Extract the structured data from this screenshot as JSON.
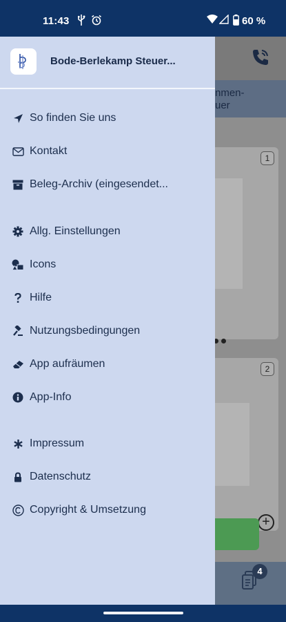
{
  "status_bar": {
    "time": "11:43",
    "battery_text": "60 %"
  },
  "drawer": {
    "title": "Bode-Berlekamp Steuer...",
    "menu_items": [
      {
        "label": "So finden Sie uns",
        "icon": "location-arrow-icon"
      },
      {
        "label": "Kontakt",
        "icon": "envelope-icon"
      },
      {
        "label": "Beleg-Archiv (eingesendet...",
        "icon": "archive-icon"
      },
      {
        "label": "Allg. Einstellungen",
        "icon": "gear-icon"
      },
      {
        "label": "Icons",
        "icon": "shapes-icon"
      },
      {
        "label": "Hilfe",
        "icon": "question-icon"
      },
      {
        "label": "Nutzungsbedingungen",
        "icon": "gavel-icon"
      },
      {
        "label": "App aufräumen",
        "icon": "eraser-icon"
      },
      {
        "label": "App-Info",
        "icon": "info-icon"
      },
      {
        "label": "Impressum",
        "icon": "asterisk-icon"
      },
      {
        "label": "Datenschutz",
        "icon": "lock-icon"
      },
      {
        "label": "Copyright & Umsetzung",
        "icon": "copyright-icon"
      }
    ]
  },
  "background_app": {
    "subheader_text": "nmen-\nuer",
    "card_numbers": [
      "1",
      "2"
    ],
    "docs_badge_count": "4"
  },
  "colors": {
    "system_bar": "#0e3366",
    "drawer_bg": "#cdd8ef",
    "text": "#1c2e4d"
  }
}
